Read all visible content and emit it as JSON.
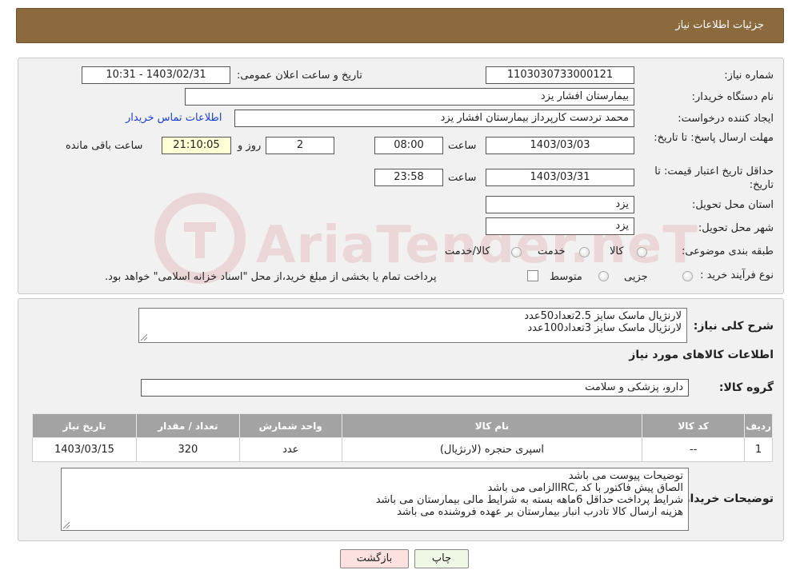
{
  "header": {
    "title": "جزئیات اطلاعات نیاز"
  },
  "form": {
    "need_number_label": "شماره نیاز:",
    "need_number": "1103030733000121",
    "announce_label": "تاریخ و ساعت اعلان عمومی:",
    "announce_value": "1403/02/31 - 10:31",
    "buyer_org_label": "نام دستگاه خریدار:",
    "buyer_org": "بیمارستان افشار یزد",
    "requester_label": "ایجاد کننده درخواست:",
    "requester": "محمد تردست کارپرداز بیمارستان افشار یزد",
    "contact_link": "اطلاعات تماس خریدار",
    "deadline_label": "مهلت ارسال پاسخ: تا تاریخ:",
    "deadline_date": "1403/03/03",
    "time_label": "ساعت",
    "deadline_time": "08:00",
    "days_value": "2",
    "days_label": "روز و",
    "remaining_time": "21:10:05",
    "remaining_label": "ساعت باقی مانده",
    "validity_label": "حداقل تاریخ اعتبار قیمت: تا تاریخ:",
    "validity_date": "1403/03/31",
    "validity_time": "23:58",
    "province_label": "استان محل تحویل:",
    "province": "یزد",
    "city_label": "شهر محل تحویل:",
    "city": "یزد",
    "category_label": "طبقه بندی موضوعی:",
    "category_options": [
      "کالا",
      "خدمت",
      "کالا/خدمت"
    ],
    "process_label": "نوع فرآیند خرید :",
    "process_options": [
      "جزیی",
      "متوسط"
    ],
    "process_note": "پرداخت تمام یا بخشی از مبلغ خرید،از محل \"اسناد خزانه اسلامی\" خواهد بود."
  },
  "details": {
    "summary_label": "شرح کلی نیاز:",
    "summary_lines": [
      "لارنژیال ماسک سایز 2.5تعداد50عدد",
      "لارنژیال ماسک سایز 3تعداد100عدد"
    ],
    "goods_info_title": "اطلاعات کالاهای مورد نیاز",
    "goods_group_label": "گروه کالا:",
    "goods_group": "دارو، پزشکی و سلامت",
    "table": {
      "headers": [
        "ردیف",
        "کد کالا",
        "نام کالا",
        "واحد شمارش",
        "تعداد / مقدار",
        "تاریخ نیاز"
      ],
      "rows": [
        [
          "1",
          "--",
          "اسپری حنجره (لارنژیال)",
          "عدد",
          "320",
          "1403/03/15"
        ]
      ]
    },
    "buyer_notes_label": "توضیحات خریدار:",
    "buyer_notes_lines": [
      "توضیحات پیوست می باشد",
      "الصاق پیش فاکتور با کد  ,IRCالزامی می باشد",
      "شرایط پرداخت   حداقل 6ماهه بسته به شرایط مالی بیمارستان می باشد",
      "هزینه ارسال کالا تادرب انبار بیمارستان بر عهده فروشنده می باشد"
    ]
  },
  "buttons": {
    "print": "چاپ",
    "back": "بازگشت"
  },
  "watermark": {
    "text": "AriaTender.neT",
    "color": "#c8282f"
  }
}
